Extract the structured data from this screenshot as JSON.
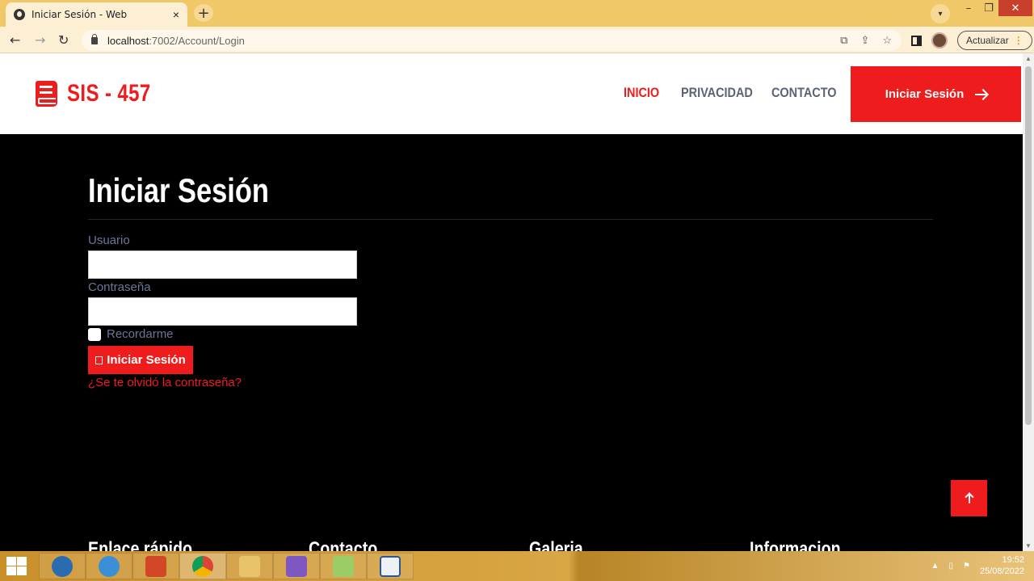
{
  "browser": {
    "tab_title": "Iniciar Sesión - Web",
    "tab_close": "×",
    "new_tab": "+",
    "url_host": "localhost",
    "url_path": ":7002/Account/Login",
    "update_label": "Actualizar"
  },
  "site": {
    "brand": "SIS - 457",
    "nav": {
      "home": "INICIO",
      "privacy": "PRIVACIDAD",
      "contact": "CONTACTO"
    },
    "cta": "Iniciar Sesión"
  },
  "login": {
    "heading": "Iniciar Sesión",
    "username_label": "Usuario",
    "username_value": "",
    "password_label": "Contraseña",
    "password_value": "",
    "remember_label": "Recordarme",
    "remember_checked": false,
    "submit_label": "Iniciar Sesión",
    "forgot_link": "¿Se te olvidó la contraseña?"
  },
  "footer": {
    "col1": "Enlace rápido",
    "col2": "Contacto",
    "col3": "Galeria",
    "col4": "Informacion"
  },
  "taskbar": {
    "time": "19:52",
    "date": "25/08/2022"
  },
  "colors": {
    "accent": "#ee1c1c",
    "label": "#6b7795",
    "chrome": "#f0c868"
  }
}
